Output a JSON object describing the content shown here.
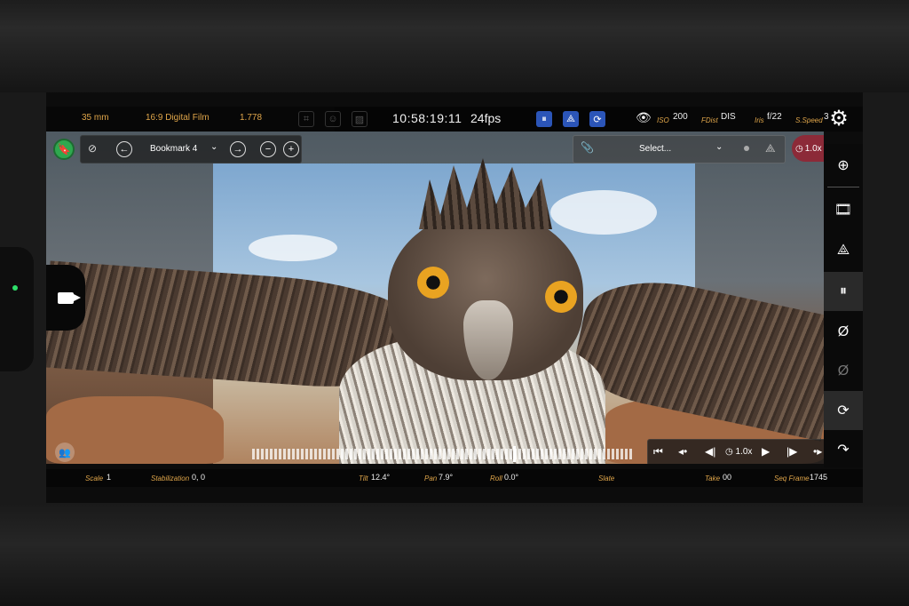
{
  "topbar": {
    "lens": "35 mm",
    "format": "16:9 Digital Film",
    "aspect": "1.778",
    "timecode": "10:58:19:11",
    "fps": "24fps",
    "iso_label": "ISO",
    "iso_value": "200",
    "fdist_label": "FDist",
    "fdist_value": "DIS",
    "iris_label": "Iris",
    "iris_value": "f/22",
    "sspeed_label": "S.Speed",
    "sspeed_value": "3"
  },
  "overlay": {
    "bookmark_label": "Bookmark 4",
    "select_placeholder": "Select...",
    "speed": "1.0x"
  },
  "transport": {
    "speed": "1.0x"
  },
  "bottombar": {
    "scale_label": "Scale",
    "scale_value": "1",
    "stabilization_label": "Stabilization",
    "stabilization_value": "0, 0",
    "tilt_label": "Tilt",
    "tilt_value": "12.4°",
    "pan_label": "Pan",
    "pan_value": "7.9°",
    "roll_label": "Roll",
    "roll_value": "0.0°",
    "slate_label": "Slate",
    "take_label": "Take",
    "take_value": "00",
    "seqframe_label": "Seq Frame",
    "seqframe_value": "1745"
  },
  "colors": {
    "label_orange": "#e0a64a",
    "bookmark_green": "#2fa84f",
    "toggle_blue": "#2b55b8",
    "speed_red": "#8c2a38",
    "status_green": "#2ee06a"
  },
  "icons": {
    "sidebar": [
      "download-icon",
      "film-icon",
      "axis-icon",
      "pause-icon",
      "zero-icon",
      "zero-dim-icon",
      "sync-icon",
      "redo-icon"
    ]
  }
}
